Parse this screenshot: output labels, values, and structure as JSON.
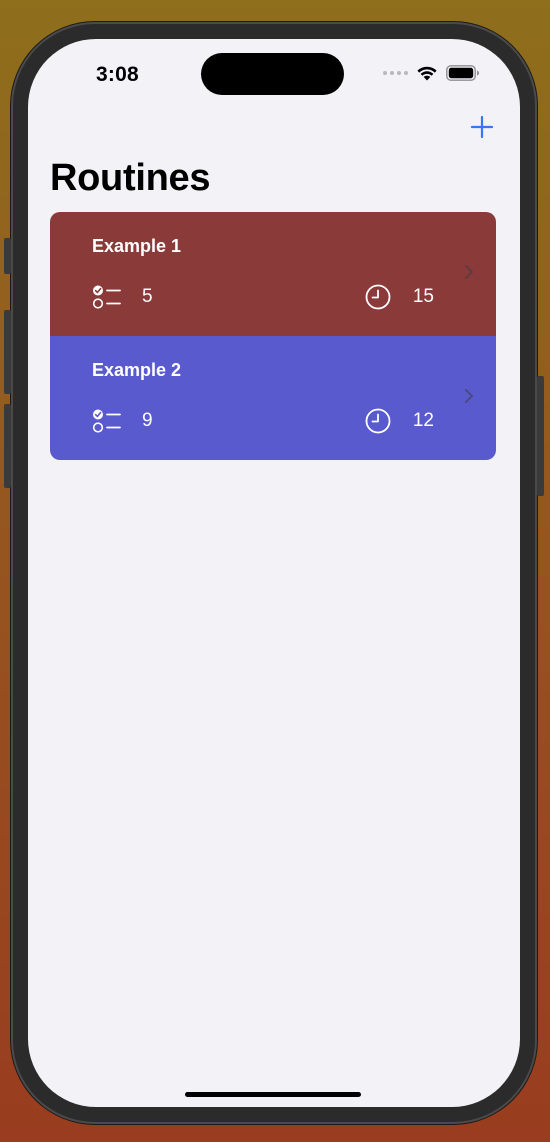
{
  "status_bar": {
    "time": "3:08"
  },
  "nav": {
    "add_icon": "plus-icon",
    "title": "Routines"
  },
  "routines": [
    {
      "name": "Example 1",
      "task_count": "5",
      "duration": "15",
      "color": "#8b3a3a"
    },
    {
      "name": "Example 2",
      "task_count": "9",
      "duration": "12",
      "color": "#5a5acf"
    }
  ],
  "colors": {
    "accent": "#3478f6",
    "background": "#f2f2f7"
  }
}
